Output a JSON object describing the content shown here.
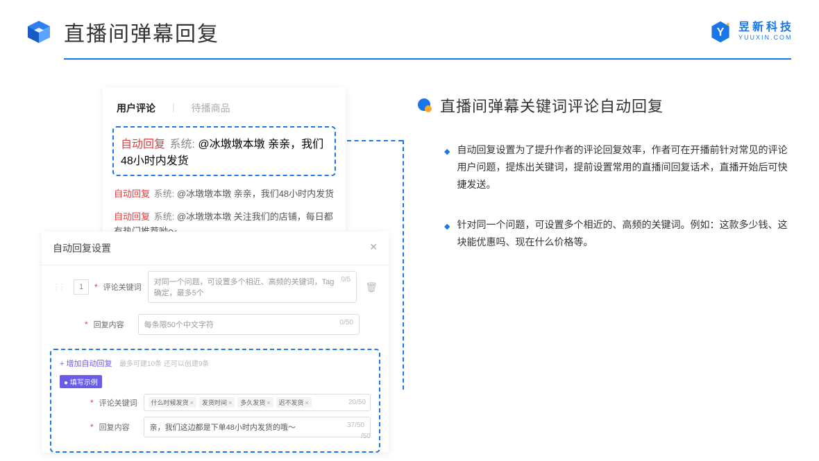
{
  "header": {
    "title": "直播间弹幕回复"
  },
  "brand": {
    "cn": "昱新科技",
    "en": "YUUXIN.COM"
  },
  "comments_card": {
    "tabs": {
      "active": "用户评论",
      "inactive": "待播商品"
    },
    "highlighted": {
      "badge": "自动回复",
      "sys": "系统:",
      "text": "@冰墩墩本墩 亲亲，我们48小时内发货"
    },
    "lines": [
      {
        "badge": "自动回复",
        "sys": "系统:",
        "text": "@冰墩墩本墩 亲亲，我们48小时内发货"
      },
      {
        "badge": "自动回复",
        "sys": "系统:",
        "text": "@冰墩墩本墩 关注我们的店铺，每日都有热门推荐呦～"
      }
    ]
  },
  "settings_card": {
    "title": "自动回复设置",
    "row_number": "1",
    "keyword_label": "评论关键词",
    "keyword_placeholder": "对同一个问题，可设置多个相近、高频的关键词，Tag确定，最多5个",
    "keyword_counter": "0/5",
    "reply_label": "回复内容",
    "reply_placeholder": "每条限50个中文字符",
    "reply_counter": "0/50",
    "add_link": "+ 增加自动回复",
    "add_hint": "最多可建10条 还可以创建9条",
    "example_badge": "● 填写示例",
    "ex_keyword_label": "评论关键词",
    "ex_tags": [
      "什么时候发货",
      "发货时间",
      "多久发货",
      "迟不发货"
    ],
    "ex_keyword_counter": "20/50",
    "ex_reply_label": "回复内容",
    "ex_reply_value": "亲，我们这边都是下单48小时内发货的哦～",
    "ex_reply_counter": "37/50",
    "stray_counter": "/50"
  },
  "right": {
    "title": "直播间弹幕关键词评论自动回复",
    "bullets": [
      "自动回复设置为了提升作者的评论回复效率，作者可在开播前针对常见的评论用户问题，提炼出关键词，提前设置常用的直播间回复话术，直播开始后可快捷发送。",
      "针对同一个问题，可设置多个相近的、高频的关键词。例如：这款多少钱、这块能优惠吗、现在什么价格等。"
    ]
  }
}
